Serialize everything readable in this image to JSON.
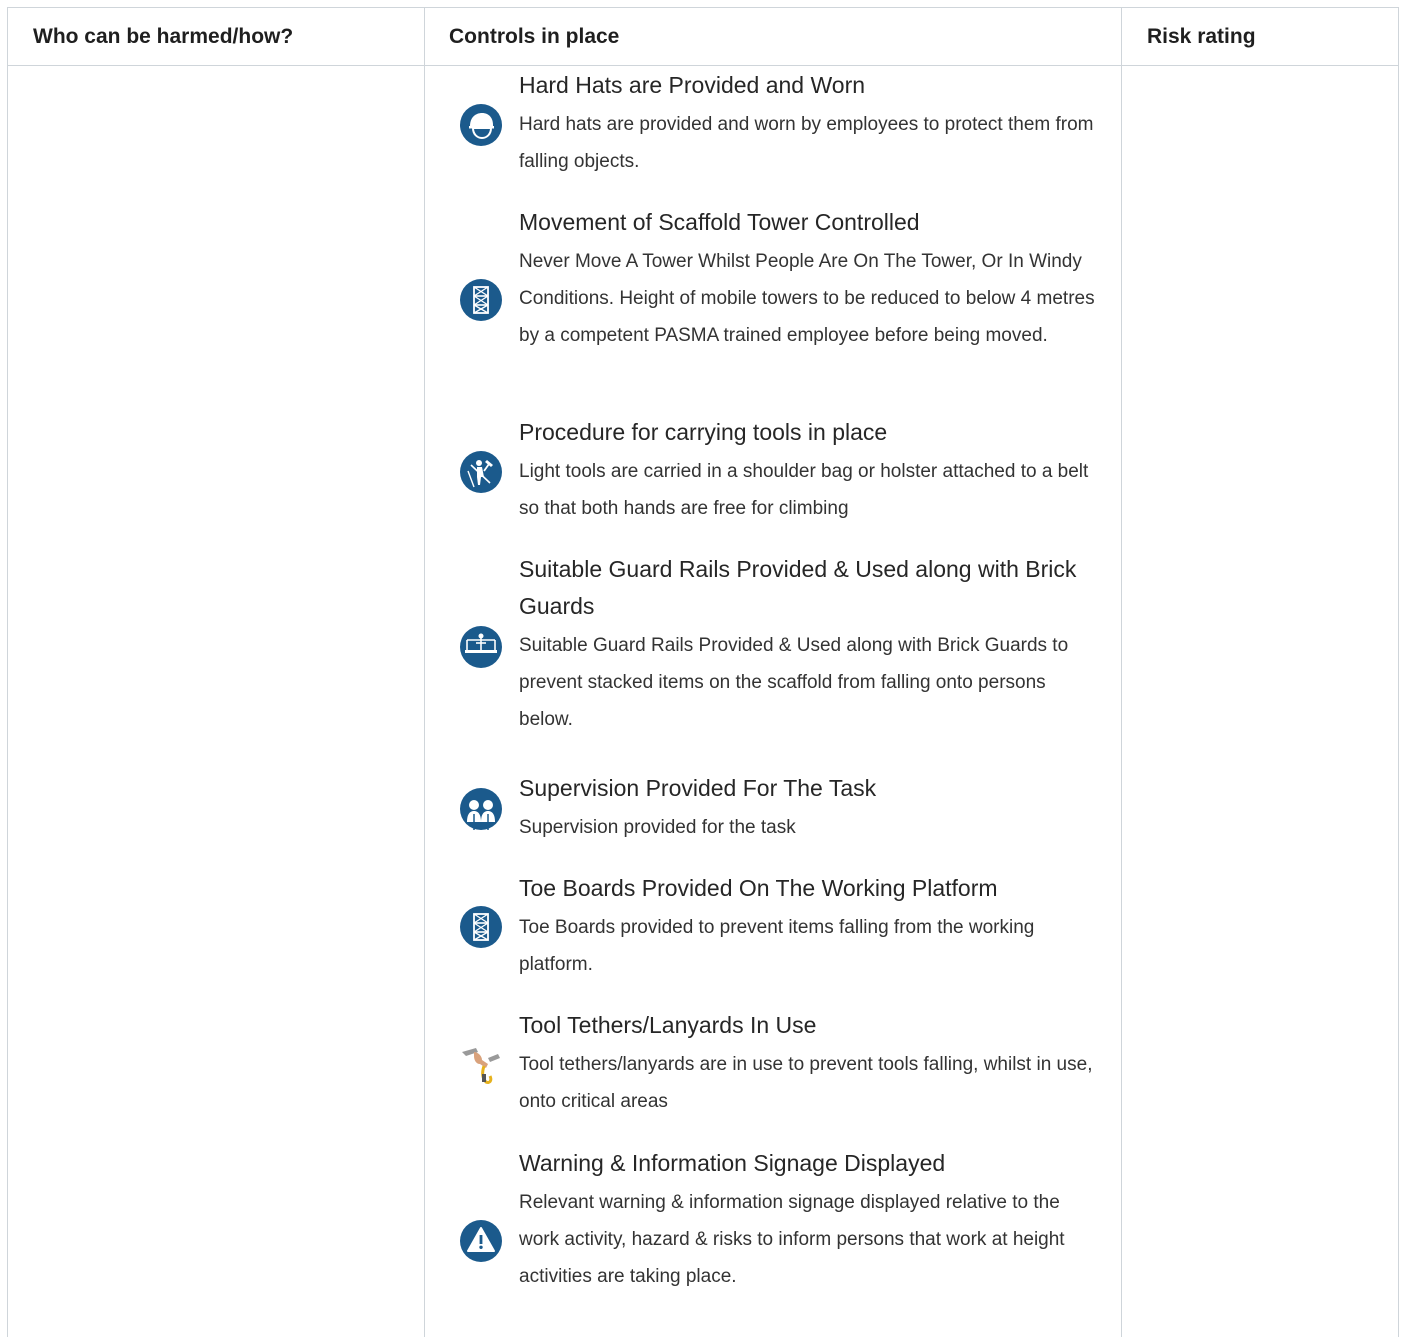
{
  "table": {
    "headers": {
      "who": "Who can be harmed/how?",
      "controls": "Controls in place",
      "risk": "Risk rating"
    },
    "controls": [
      {
        "title": "Hard Hats are Provided and Worn",
        "description": "Hard hats are provided and worn by employees to protect them from falling objects.",
        "icon": "hard-hat-icon"
      },
      {
        "title": "Movement of Scaffold Tower Controlled",
        "description": "Never Move A Tower Whilst People Are On The Tower, Or In Windy Conditions. Height of mobile towers to be reduced to below 4 metres by a competent PASMA trained employee before being moved.",
        "icon": "scaffold-tower-icon"
      },
      {
        "title": "Procedure for carrying tools in place",
        "description": "Light tools are carried in a shoulder bag or holster attached to a belt so that both hands are free for climbing",
        "icon": "tool-carrying-icon"
      },
      {
        "title": "Suitable Guard Rails Provided & Used along with Brick Guards",
        "description": "Suitable Guard Rails Provided & Used along with Brick Guards to prevent stacked items on the scaffold from falling onto persons below.",
        "icon": "guard-rail-icon"
      },
      {
        "title": "Supervision Provided For The Task",
        "description": "Supervision provided for the task",
        "icon": "supervision-icon"
      },
      {
        "title": "Toe Boards Provided On The Working Platform",
        "description": "Toe Boards provided to prevent items falling from the working platform.",
        "icon": "scaffold-tower-icon"
      },
      {
        "title": "Tool Tethers/Lanyards In Use",
        "description": "Tool tethers/lanyards are in use to prevent tools falling, whilst in use, onto critical areas",
        "icon": "tool-tether-icon"
      },
      {
        "title": "Warning & Information Signage Displayed",
        "description": "Relevant warning & information signage displayed relative to the work activity, hazard & risks to inform persons that work at height activities are taking place.",
        "icon": "warning-icon"
      }
    ]
  },
  "colors": {
    "icon_blue": "#1b5a8c",
    "border": "#cfd5da",
    "tether_yellow": "#e6b21e"
  }
}
